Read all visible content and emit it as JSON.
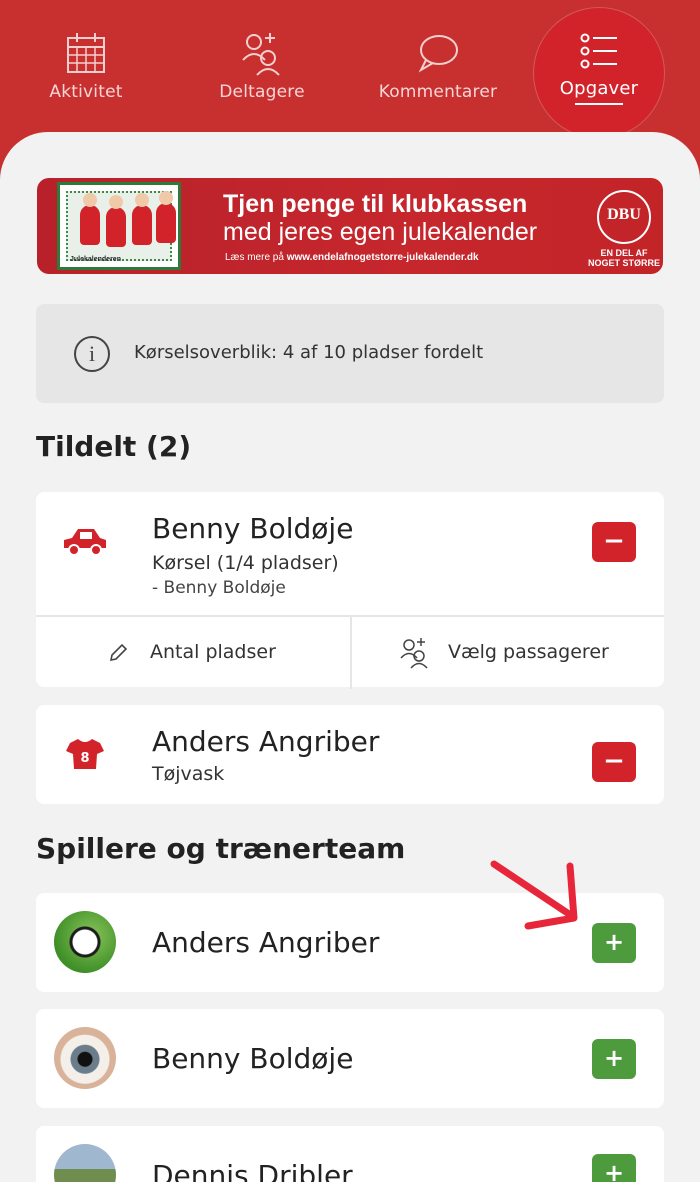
{
  "nav": {
    "tabs": [
      {
        "label": "Aktivitet",
        "icon": "calendar-icon"
      },
      {
        "label": "Deltagere",
        "icon": "participants-icon"
      },
      {
        "label": "Kommentarer",
        "icon": "comment-icon"
      },
      {
        "label": "Opgaver",
        "icon": "task-list-icon",
        "active": true
      }
    ]
  },
  "banner": {
    "title": "Tjen penge til klubkassen",
    "subtitle": "med jeres egen julekalender",
    "link_prefix": "Læs mere på",
    "link_url": "www.endelafnogetstorre-julekalender.dk",
    "logo_text": "DBU",
    "tagline_1": "EN DEL AF",
    "tagline_2": "NOGET STØRRE",
    "photo_caption": "Julekalenderen"
  },
  "info": {
    "text": "Kørselsoverblik: 4 af 10 pladser fordelt"
  },
  "assigned": {
    "heading": "Tildelt (2)",
    "items": [
      {
        "name": "Benny Boldøje",
        "task": "Kørsel (1/4 pladser)",
        "detail": "- Benny Boldøje",
        "icon": "car-icon",
        "action_seats": "Antal pladser",
        "action_passengers": "Vælg passagerer"
      },
      {
        "name": "Anders Angriber",
        "task": "Tøjvask",
        "icon": "jersey-icon",
        "jersey_number": "8"
      }
    ]
  },
  "players": {
    "heading": "Spillere og trænerteam",
    "items": [
      {
        "name": "Anders Angriber"
      },
      {
        "name": "Benny Boldøje"
      },
      {
        "name": "Dennis Dribler"
      }
    ]
  },
  "colors": {
    "brand_red": "#c8302f",
    "remove_red": "#d2232a",
    "add_green": "#4d9b3d",
    "arrow_red": "#e8263a"
  }
}
